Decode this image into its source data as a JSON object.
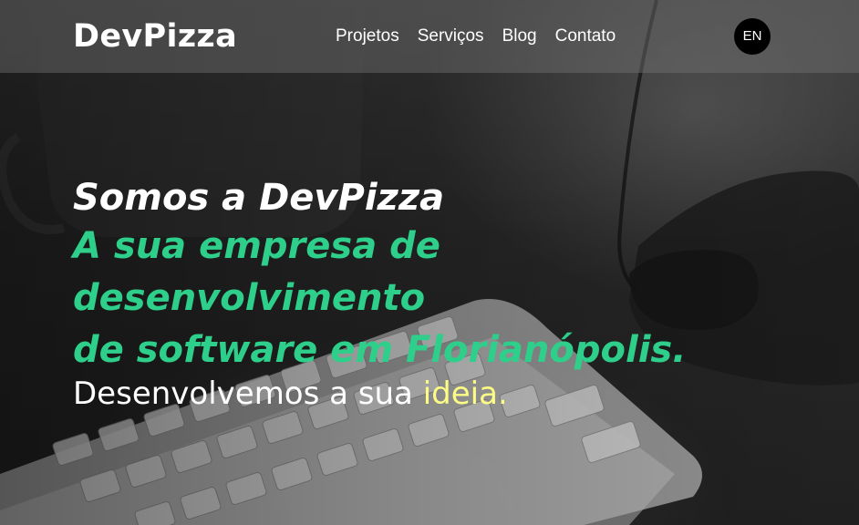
{
  "colors": {
    "accent_green": "#2ecf8a",
    "highlight_yellow": "#fdfd85",
    "header_overlay": "rgba(120,120,120,0.42)",
    "lang_button_bg": "#000000"
  },
  "header": {
    "logo": "DevPizza",
    "nav": [
      {
        "label": "Projetos"
      },
      {
        "label": "Serviços"
      },
      {
        "label": "Blog"
      },
      {
        "label": "Contato"
      }
    ],
    "language_button": "EN"
  },
  "hero": {
    "title": "Somos a DevPizza",
    "subtitle_lines": [
      "A sua empresa de",
      "desenvolvimento",
      "de software em Florianópolis."
    ],
    "tagline_prefix": "Desenvolvemos a sua ",
    "tagline_highlight": "ideia."
  }
}
